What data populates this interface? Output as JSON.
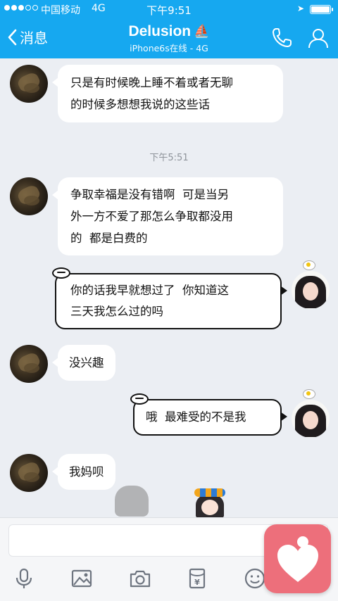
{
  "status_bar": {
    "signal": "●●●○○",
    "carrier": "中国移动",
    "network": "4G",
    "time": "下午9:51",
    "battery_percent": 100
  },
  "header": {
    "back_label": "消息",
    "title": "Delusion",
    "title_emoji": "⛵",
    "subtitle": "iPhone6s在线 - 4G",
    "icons": [
      "phone-icon",
      "profile-icon"
    ]
  },
  "messages": [
    {
      "sender": "friend",
      "lines": [
        "只是有时候晚上睡不着或者无聊",
        "的时候多想想我说的这些话"
      ]
    },
    {
      "type": "timestamp",
      "text": "下午5:51"
    },
    {
      "sender": "friend",
      "lines": [
        "争取幸福是没有错啊  可是当另",
        "外一方不爱了那怎么争取都没用",
        "的  都是白费的"
      ]
    },
    {
      "sender": "me",
      "lines": [
        "你的话我早就想过了  你知道这",
        "三天我怎么过的吗"
      ]
    },
    {
      "sender": "friend",
      "lines": [
        "没兴趣"
      ]
    },
    {
      "sender": "me",
      "lines": [
        "哦  最难受的不是我"
      ]
    },
    {
      "sender": "friend",
      "lines": [
        "我妈呗"
      ]
    }
  ],
  "toolbar": {
    "icons": [
      "microphone-icon",
      "image-icon",
      "camera-icon",
      "red-packet-icon",
      "emoji-icon"
    ]
  },
  "floating_app": {
    "icon": "heart-icon",
    "color": "#ed6f7b"
  },
  "colors": {
    "header": "#16a8f0",
    "background": "#ebeef3",
    "timestamp": "#8e939a"
  }
}
